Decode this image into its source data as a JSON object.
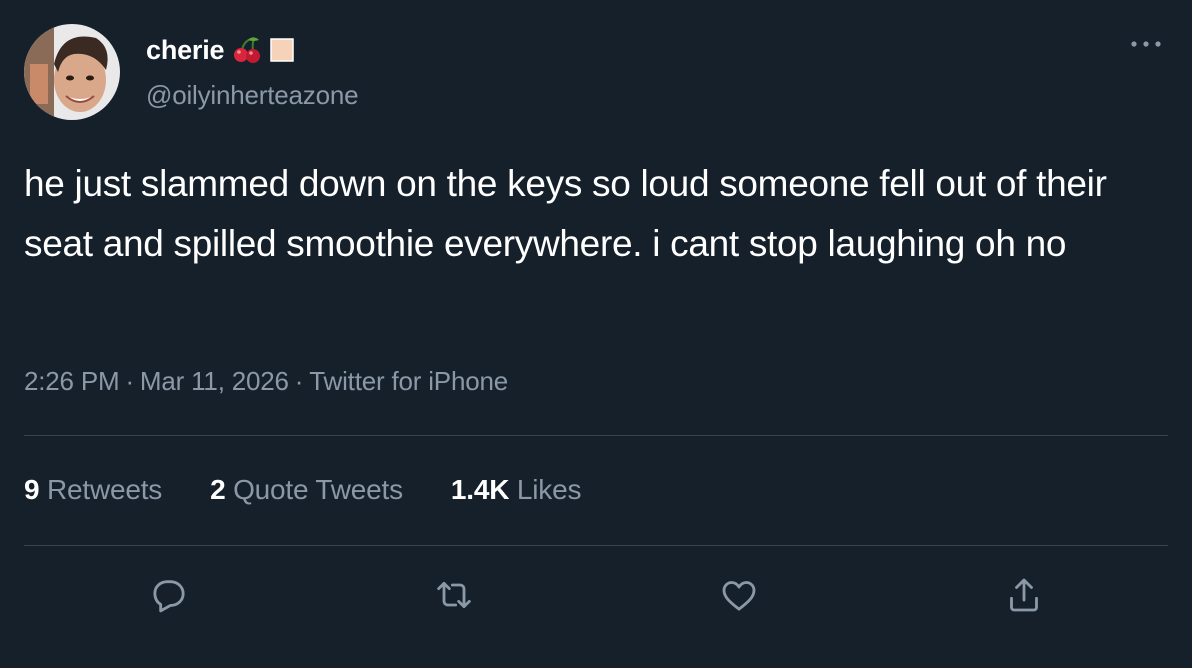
{
  "tweet": {
    "author": {
      "display_name": "cherie",
      "name_emojis": [
        "cherries-emoji",
        "peach-square-emoji"
      ],
      "handle": "@oilyinherteazone",
      "avatar": "profile-photo"
    },
    "text": "he just slammed down on the keys so loud someone fell out of their seat and spilled smoothie everywhere. i cant stop laughing oh no",
    "meta": {
      "time": "2:26 PM",
      "separator": "·",
      "date": "Mar 11, 2026",
      "source": "Twitter for iPhone"
    },
    "stats": [
      {
        "count": "9",
        "label": "Retweets"
      },
      {
        "count": "2",
        "label": "Quote Tweets"
      },
      {
        "count": "1.4K",
        "label": "Likes"
      }
    ],
    "actions": [
      "reply-icon",
      "retweet-icon",
      "like-icon",
      "share-icon"
    ]
  },
  "colors": {
    "background": "#15202b",
    "primary_text": "#ffffff",
    "secondary_text": "#8b98a5",
    "divider": "#38444d"
  }
}
